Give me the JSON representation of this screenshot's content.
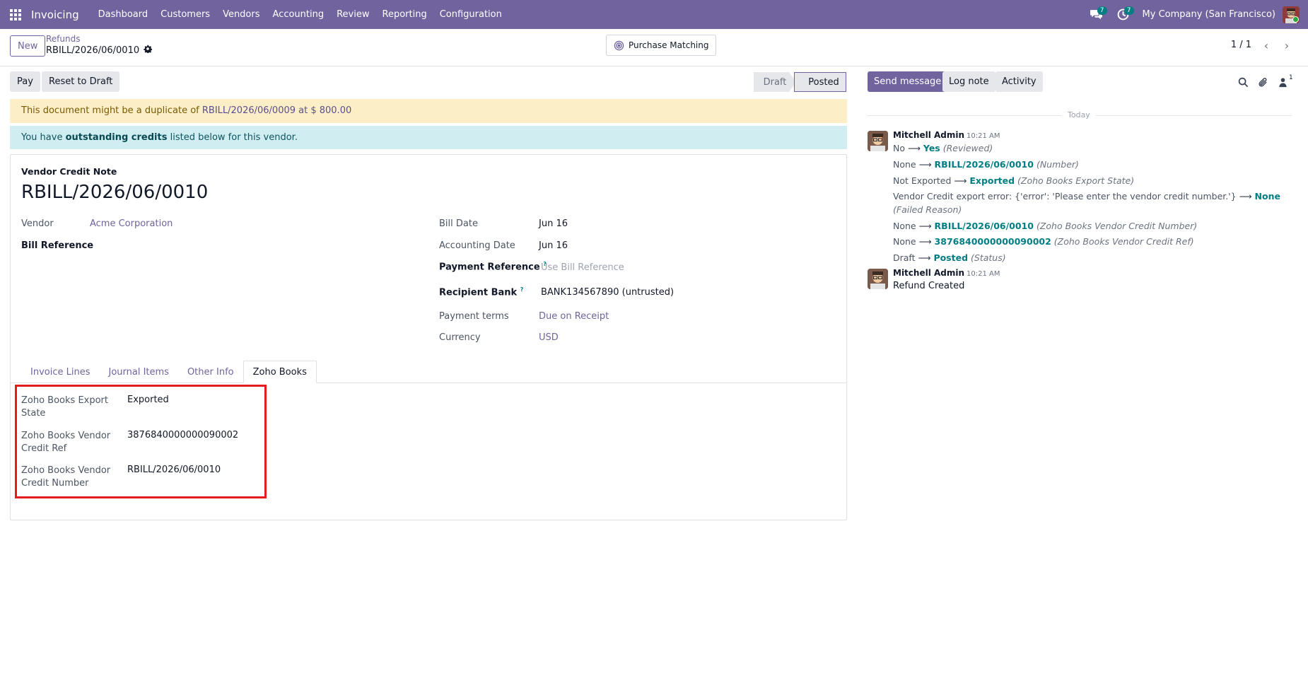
{
  "navbar": {
    "app_name": "Invoicing",
    "menu": [
      "Dashboard",
      "Customers",
      "Vendors",
      "Accounting",
      "Review",
      "Reporting",
      "Configuration"
    ],
    "messages_badge": "7",
    "activities_badge": "7",
    "company": "My Company (San Francisco)"
  },
  "control": {
    "new_label": "New",
    "breadcrumb_parent": "Refunds",
    "breadcrumb_current": "RBILL/2026/06/0010",
    "purchase_matching_label": "Purchase Matching",
    "pager": "1 / 1"
  },
  "actions": {
    "pay_label": "Pay",
    "reset_label": "Reset to Draft",
    "status_draft": "Draft",
    "status_posted": "Posted"
  },
  "alerts": {
    "duplicate_prefix": "This document might be a duplicate of",
    "duplicate_link": "RBILL/2026/06/0009 at $ 800.00",
    "credits_prefix": "You have",
    "credits_bold": "outstanding credits",
    "credits_suffix": "listed below for this vendor."
  },
  "form": {
    "doc_type": "Vendor Credit Note",
    "title": "RBILL/2026/06/0010",
    "vendor_label": "Vendor",
    "vendor_value": "Acme Corporation",
    "bill_reference_label": "Bill Reference",
    "bill_date_label": "Bill Date",
    "bill_date_value": "Jun 16",
    "accounting_date_label": "Accounting Date",
    "accounting_date_value": "Jun 16",
    "payment_reference_label": "Payment Reference",
    "payment_reference_placeholder": "Use Bill Reference",
    "recipient_bank_label": "Recipient Bank",
    "recipient_bank_value": "BANK134567890 (untrusted)",
    "payment_terms_label": "Payment terms",
    "payment_terms_value": "Due on Receipt",
    "currency_label": "Currency",
    "currency_value": "USD",
    "help_mark": "?"
  },
  "tabs": [
    "Invoice Lines",
    "Journal Items",
    "Other Info",
    "Zoho Books"
  ],
  "zoho": {
    "export_state_label": "Zoho Books Export State",
    "export_state_value": "Exported",
    "credit_ref_label": "Zoho Books Vendor Credit Ref",
    "credit_ref_value": "3876840000000090002",
    "credit_number_label": "Zoho Books Vendor Credit Number",
    "credit_number_value": "RBILL/2026/06/0010"
  },
  "chatter": {
    "send_message": "Send message",
    "log_note": "Log note",
    "activity": "Activity",
    "follower_count": "1",
    "day_label": "Today",
    "messages": [
      {
        "author": "Mitchell Admin",
        "time": "10:21 AM",
        "tracking": [
          {
            "old": "No",
            "new": "Yes",
            "field": "(Reviewed)"
          },
          {
            "old": "None",
            "new": "RBILL/2026/06/0010",
            "field": "(Number)"
          },
          {
            "old": "Not Exported",
            "new": "Exported",
            "field": "(Zoho Books Export State)"
          },
          {
            "old": "Vendor Credit export error: {'error': 'Please enter the vendor credit number.'}",
            "new": "None",
            "field": "(Failed Reason)"
          },
          {
            "old": "None",
            "new": "RBILL/2026/06/0010",
            "field": "(Zoho Books Vendor Credit Number)"
          },
          {
            "old": "None",
            "new": "3876840000000090002",
            "field": "(Zoho Books Vendor Credit Ref)"
          },
          {
            "old": "Draft",
            "new": "Posted",
            "field": "(Status)"
          }
        ]
      },
      {
        "author": "Mitchell Admin",
        "time": "10:21 AM",
        "body": "Refund Created"
      }
    ]
  }
}
